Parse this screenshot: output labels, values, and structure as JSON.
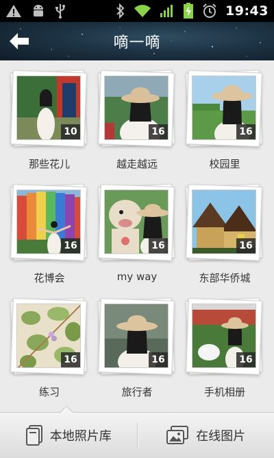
{
  "status_bar": {
    "time": "19:43",
    "icons": [
      "warning-icon",
      "android-debug-icon",
      "usb-icon",
      "bluetooth-icon",
      "wifi-icon",
      "signal-icon",
      "battery-charging-icon",
      "alarm-icon"
    ]
  },
  "header": {
    "title": "嘀一嘀",
    "back_icon": "back-arrow-icon"
  },
  "albums": [
    {
      "name": "那些花儿",
      "count": "10"
    },
    {
      "name": "越走越远",
      "count": "16"
    },
    {
      "name": "校园里",
      "count": "16"
    },
    {
      "name": "花博会",
      "count": "16"
    },
    {
      "name": "my way",
      "count": "16"
    },
    {
      "name": "东部华侨城",
      "count": "16"
    },
    {
      "name": "练习",
      "count": "16"
    },
    {
      "name": "旅行者",
      "count": "16"
    },
    {
      "name": "手机相册",
      "count": "16"
    }
  ],
  "tabs": [
    {
      "label": "本地照片库",
      "icon": "local-gallery-icon",
      "selected": true
    },
    {
      "label": "在线图片",
      "icon": "online-gallery-icon",
      "selected": false
    }
  ],
  "colors": {
    "header_bg": "#1d3344",
    "count_badge": "#282828",
    "page_bg": "#ebebeb"
  }
}
